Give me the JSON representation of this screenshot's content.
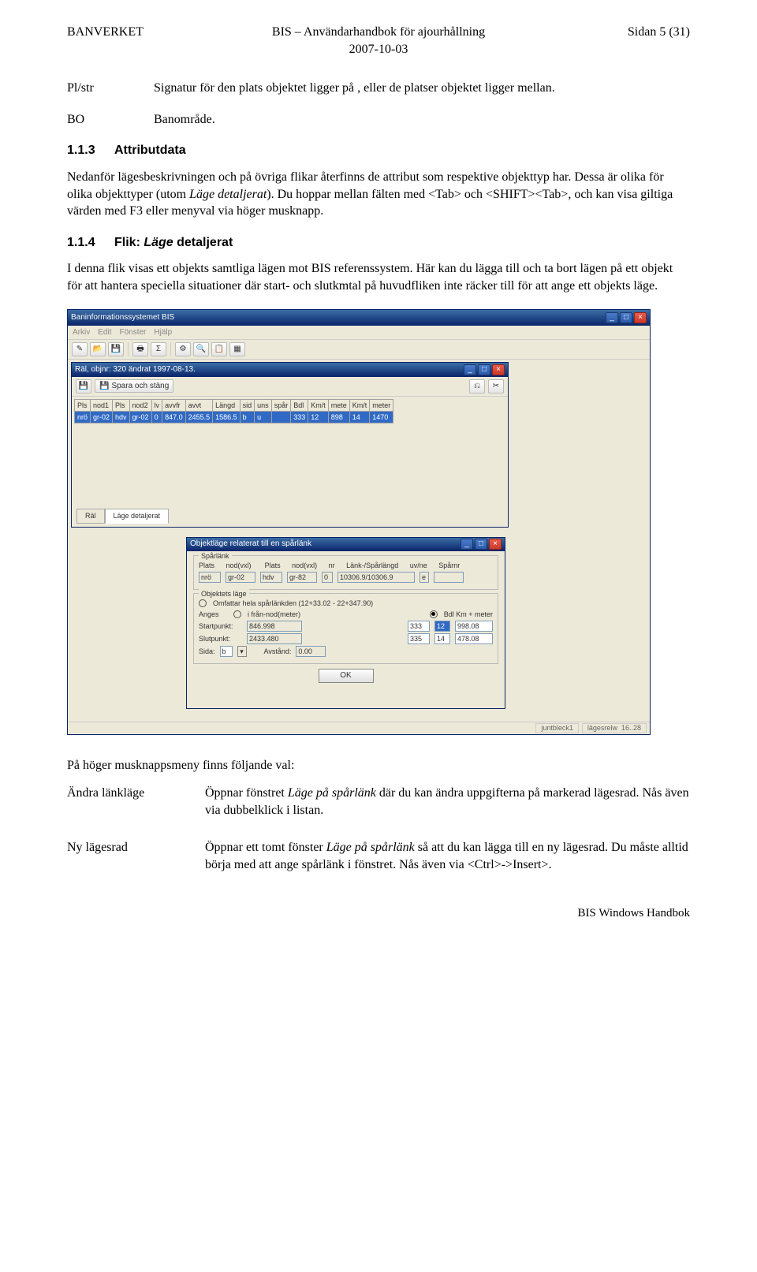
{
  "header": {
    "org": "BANVERKET",
    "title": "BIS – Användarhandbok för ajourhållning",
    "date": "2007-10-03",
    "page": "Sidan 5 (31)"
  },
  "defs": [
    {
      "term": "Pl/str",
      "desc": "Signatur för den plats objektet ligger på , eller de platser objektet ligger mellan."
    },
    {
      "term": "BO",
      "desc": "Banområde."
    }
  ],
  "sec113": {
    "num": "1.1.3",
    "title": "Attributdata",
    "text": "Nedanför lägesbeskrivningen och på övriga flikar återfinns de attribut som respektive objekttyp har. Dessa är olika för olika objekttyper (utom Läge detaljerat). Du hoppar mellan fälten med <Tab> och <SHIFT><Tab>, och kan visa giltiga värden med F3 eller menyval via höger musknapp.",
    "italic_phrase": "Läge detaljerat"
  },
  "sec114": {
    "num": "1.1.4",
    "title_pre": "Flik: ",
    "title_italic": "Läge",
    "title_post": " detaljerat",
    "text": "I denna flik visas ett objekts samtliga lägen mot BIS referenssystem. Här kan du lägga till och ta bort lägen på ett objekt för att hantera speciella situationer där start- och slutkmtal på huvudfliken inte räcker till för att ange ett objekts läge."
  },
  "screenshot": {
    "app_title": "Baninformationssystemet BIS",
    "menus": [
      "Arkiv",
      "Edit",
      "Fönster",
      "Hjälp"
    ],
    "child_title": "Räl, objnr: 320 ändrat 1997-08-13.",
    "save_label": "Spara och stäng",
    "grid_headers": [
      "Pls",
      "nod1",
      "Pls",
      "nod2",
      "lv",
      "avvfr",
      "avvt",
      "Längd",
      "sid",
      "uns",
      "spår",
      "Bdl",
      "Km/t",
      "mete",
      "Km/t",
      "meter"
    ],
    "grid_row": [
      "nrö",
      "gr-02",
      "hdv",
      "gr-02",
      "0",
      "847.0",
      "2455.5",
      "1586.5",
      "b",
      "u",
      "",
      "333",
      "12",
      "898",
      "14",
      "1470"
    ],
    "tabs": [
      "Räl",
      "Läge detaljerat"
    ],
    "dlg_title": "Objektläge relaterat till en spårlänk",
    "sparlank": {
      "legend": "Spårlänk",
      "labels": [
        "Plats",
        "nod(vxl)",
        "Plats",
        "nod(vxl)",
        "nr",
        "Länk-/Spårlängd",
        "uv/ne",
        "Spårnr"
      ],
      "values": [
        "nrö",
        "gr-02",
        "hdv",
        "gr-82",
        "0",
        "10306.9/10306.9",
        "e",
        ""
      ]
    },
    "objlage": {
      "legend": "Objektets läge",
      "omfattar": "Omfattar hela spårlänkden (12+33.02 - 22+347.90)",
      "anges": "Anges     i från-nod(meter)",
      "bdl_label": "Bdl  Km + meter",
      "start_label": "Startpunkt:",
      "start_val": "846.998",
      "start_bdl": [
        "333",
        "12",
        "998.08"
      ],
      "slut_label": "Slutpunkt:",
      "slut_val": "2433.480",
      "slut_bdl": [
        "335",
        "14",
        "478.08"
      ],
      "sida_label": "Sida:",
      "sida_val": "b",
      "avstand_label": "Avstånd:",
      "avstand_val": "0.00",
      "ok": "OK"
    },
    "status": {
      "left": "juntbleck1",
      "right_label": "lägesrelw",
      "right_val": "16..28"
    }
  },
  "after_text": "På höger musknappsmeny finns följande val:",
  "menu_items": [
    {
      "term": "Ändra länkläge",
      "desc_pre": "Öppnar fönstret ",
      "desc_italic": "Läge på spårlänk",
      "desc_post": " där du kan ändra uppgifterna på markerad lägesrad. Nås även via dubbelklick i listan."
    },
    {
      "term": "Ny lägesrad",
      "desc_pre": "Öppnar ett tomt fönster ",
      "desc_italic": "Läge på spårlänk",
      "desc_post": " så att du kan lägga till en ny lägesrad. Du måste alltid börja med att ange spårlänk i fönstret. Nås även via <Ctrl>->Insert>."
    }
  ],
  "footer": "BIS Windows Handbok"
}
